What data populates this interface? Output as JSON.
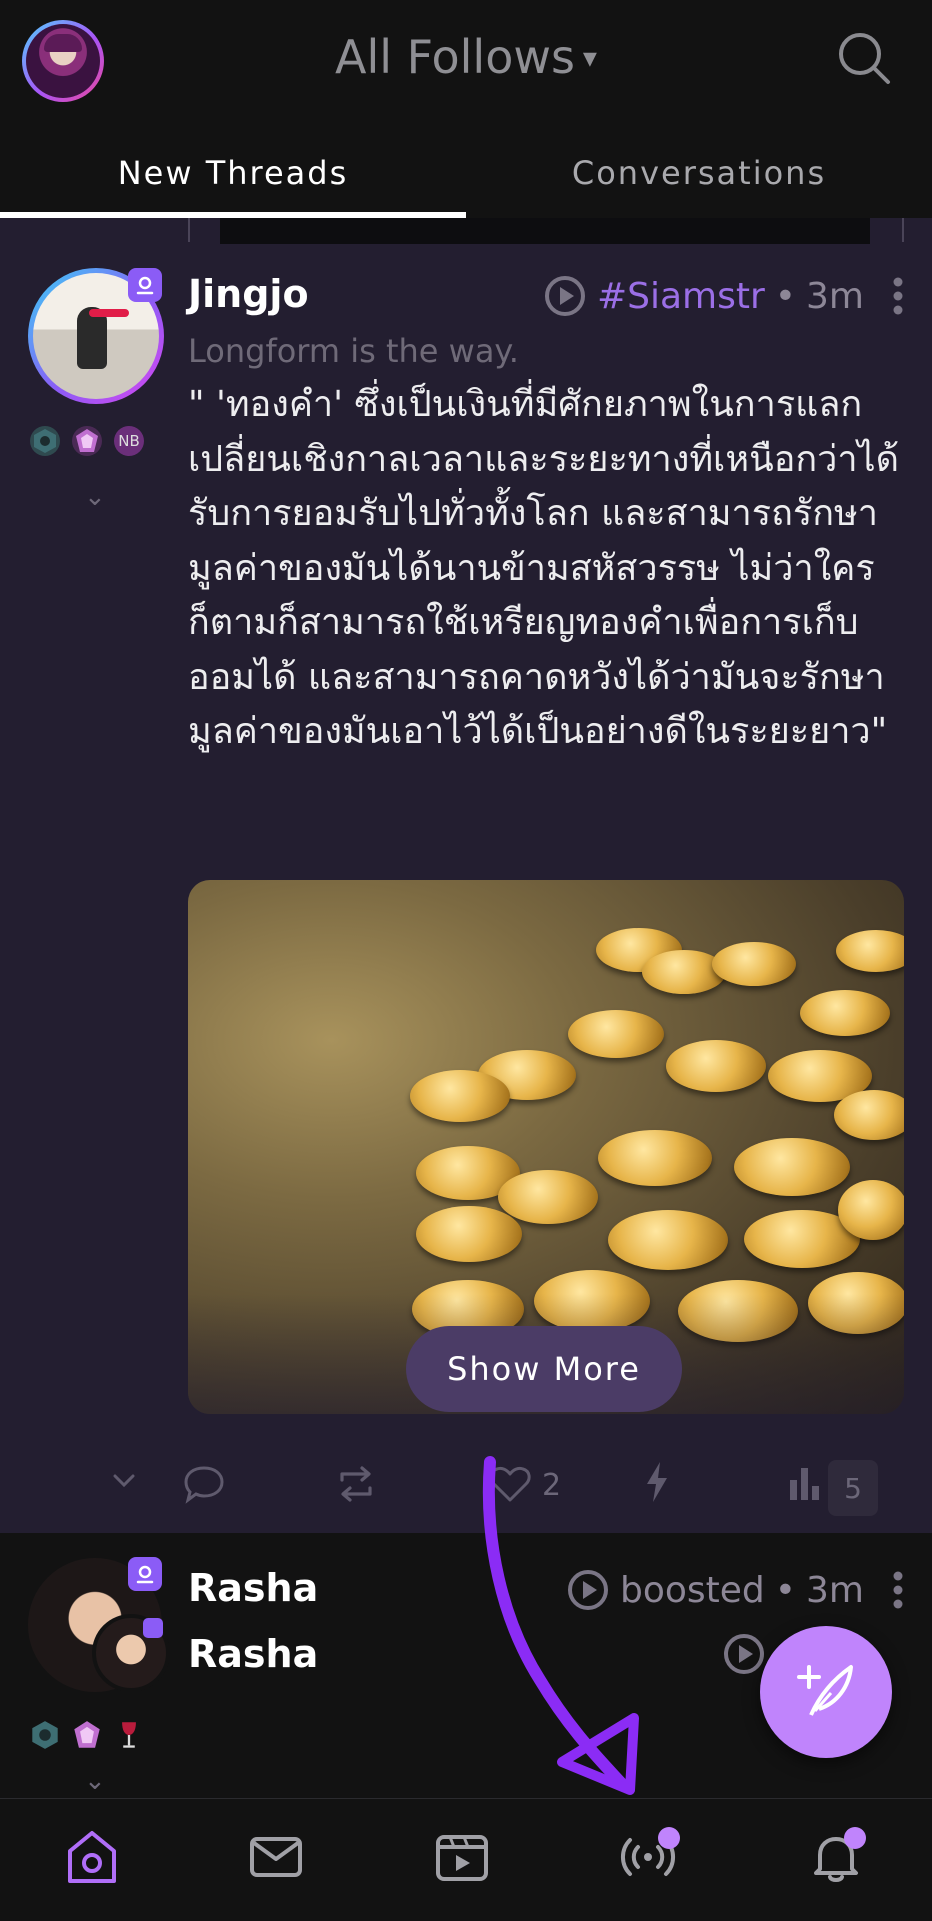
{
  "header": {
    "feed_title": "All Follows",
    "chevron": "▾",
    "icons": {
      "profile": "avatar",
      "search": "search-icon"
    }
  },
  "tabs": [
    {
      "label": "New Threads",
      "active": true
    },
    {
      "label": "Conversations",
      "active": false
    }
  ],
  "post": {
    "author": "Jingjo",
    "subtitle": "Longform is the way.",
    "hashtag": "#Siamstr",
    "separator": "•",
    "time": "3m",
    "badge_text": "NB",
    "text": "\" 'ทองคำ' ซึ่งเป็นเงินที่มีศักยภาพในการแลกเปลี่ยนเชิงกาลเวลาและระยะทางที่เหนือกว่าได้รับการยอมรับไปทั่วทั้งโลก และสามารถรักษามูลค่าของมันได้นานข้ามสหัสวรรษ ไม่ว่าใครก็ตามก็สามารถใช้เหรียญทองคำเพื่อการเก็บออมได้ และสามารถคาดหวังได้ว่ามันจะรักษามูลค่าของมันเอาไว้ได้เป็นอย่างดีในระยะยาว\"",
    "image_alt": "gold coins",
    "show_more": "Show More",
    "likes": "2",
    "stats": "5"
  },
  "next_post": {
    "booster": "Rasha",
    "author": "Rasha",
    "boosted_label": "boosted",
    "separator": "•",
    "time": "3m"
  },
  "nav": {
    "items": [
      "home-icon",
      "messages-icon",
      "media-icon",
      "live-icon",
      "notifications-icon"
    ]
  },
  "colors": {
    "accent": "#c084fc",
    "post_background": "#231e30",
    "app_background": "#121212"
  }
}
